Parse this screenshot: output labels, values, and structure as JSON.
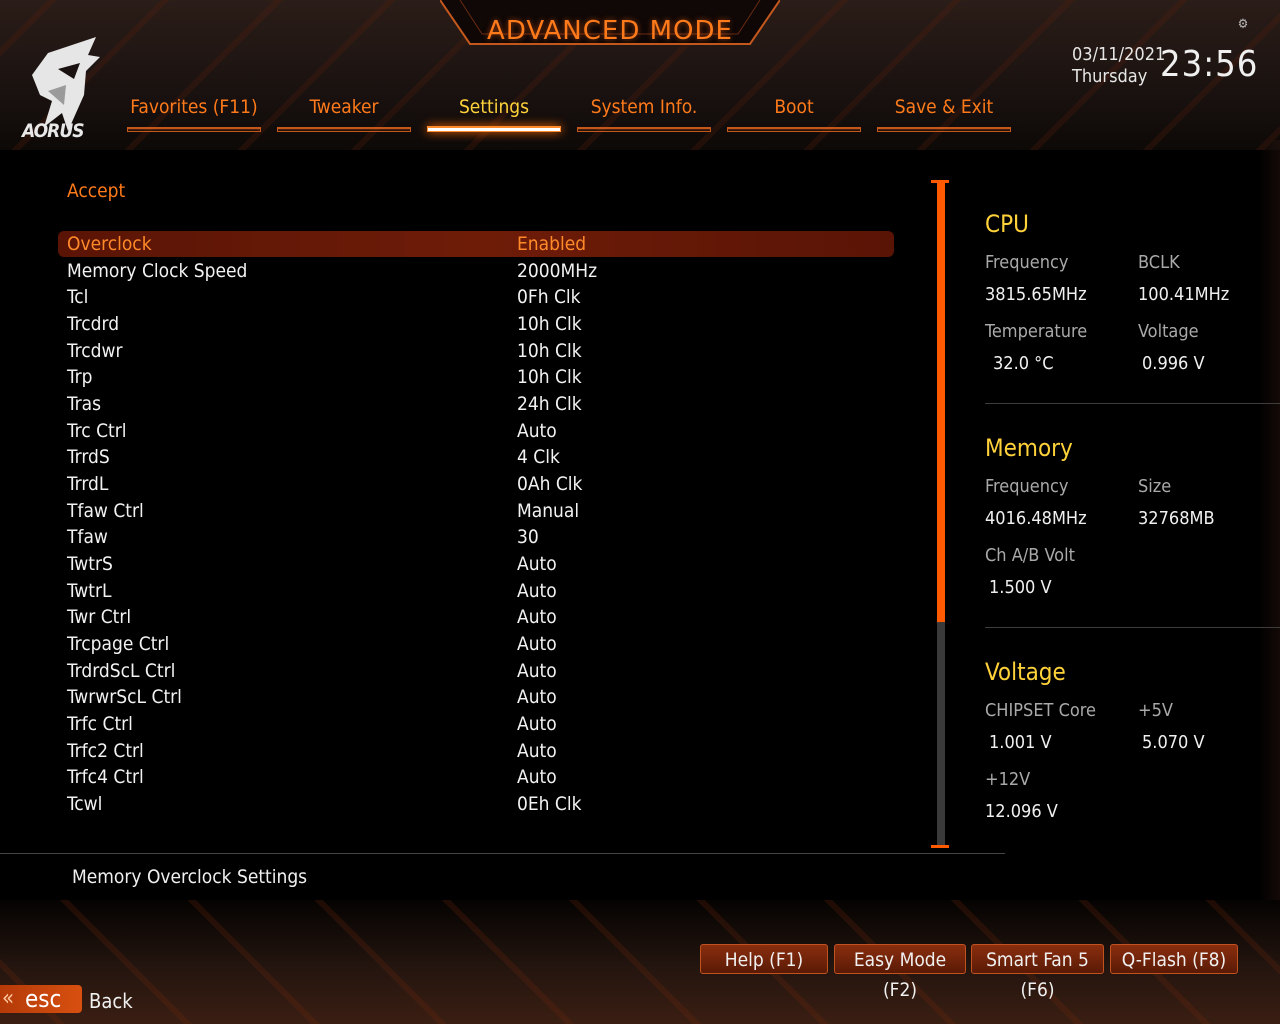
{
  "header": {
    "title": "ADVANCED MODE",
    "logo_text": "AORUS",
    "date": "03/11/2021",
    "weekday": "Thursday",
    "time": "23:56",
    "settings_icon": "gear-icon"
  },
  "tabs": [
    {
      "label": "Favorites (F11)"
    },
    {
      "label": "Tweaker"
    },
    {
      "label": "Settings"
    },
    {
      "label": "System Info."
    },
    {
      "label": "Boot"
    },
    {
      "label": "Save & Exit"
    }
  ],
  "main": {
    "accept_label": "Accept",
    "rows": [
      {
        "label": "Overclock",
        "value": "Enabled"
      },
      {
        "label": "Memory Clock Speed",
        "value": "2000MHz"
      },
      {
        "label": "Tcl",
        "value": "0Fh Clk"
      },
      {
        "label": "Trcdrd",
        "value": "10h Clk"
      },
      {
        "label": "Trcdwr",
        "value": "10h Clk"
      },
      {
        "label": "Trp",
        "value": "10h Clk"
      },
      {
        "label": "Tras",
        "value": "24h Clk"
      },
      {
        "label": "Trc Ctrl",
        "value": "Auto"
      },
      {
        "label": "TrrdS",
        "value": "4 Clk"
      },
      {
        "label": "TrrdL",
        "value": "0Ah Clk"
      },
      {
        "label": "Tfaw Ctrl",
        "value": "Manual"
      },
      {
        "label": "Tfaw",
        "value": "30"
      },
      {
        "label": "TwtrS",
        "value": "Auto"
      },
      {
        "label": "TwtrL",
        "value": "Auto"
      },
      {
        "label": "Twr Ctrl",
        "value": "Auto"
      },
      {
        "label": "Trcpage Ctrl",
        "value": "Auto"
      },
      {
        "label": "TrdrdScL Ctrl",
        "value": "Auto"
      },
      {
        "label": "TwrwrScL Ctrl",
        "value": "Auto"
      },
      {
        "label": "Trfc Ctrl",
        "value": "Auto"
      },
      {
        "label": "Trfc2 Ctrl",
        "value": "Auto"
      },
      {
        "label": "Trfc4 Ctrl",
        "value": "Auto"
      },
      {
        "label": "Tcwl",
        "value": "0Eh Clk"
      }
    ]
  },
  "cpu": {
    "title": "CPU",
    "frequency_label": "Frequency",
    "frequency_value": "3815.65MHz",
    "bclk_label": "BCLK",
    "bclk_value": "100.41MHz",
    "temperature_label": "Temperature",
    "temperature_value": "32.0 °C",
    "voltage_label": "Voltage",
    "voltage_value": "0.996 V"
  },
  "memory": {
    "title": "Memory",
    "frequency_label": "Frequency",
    "frequency_value": "4016.48MHz",
    "size_label": "Size",
    "size_value": "32768MB",
    "chab_label": "Ch A/B Volt",
    "chab_value": "1.500 V"
  },
  "voltage": {
    "title": "Voltage",
    "chipset_label": "CHIPSET Core",
    "chipset_value": "1.001 V",
    "p5v_label": "+5V",
    "p5v_value": "5.070 V",
    "p12v_label": "+12V",
    "p12v_value": "12.096 V"
  },
  "footer": {
    "help_text": "Memory Overclock Settings",
    "buttons": [
      {
        "label": "Help (F1)"
      },
      {
        "label": "Easy Mode (F2)"
      },
      {
        "label": "Smart Fan 5 (F6)"
      },
      {
        "label": "Q-Flash (F8)"
      }
    ],
    "esc_key": "esc",
    "back_label": "Back"
  },
  "colors": {
    "accent_orange": "#ff7a1a",
    "highlight_yellow": "#ffd23a",
    "selected_row": "#6e1c08"
  }
}
